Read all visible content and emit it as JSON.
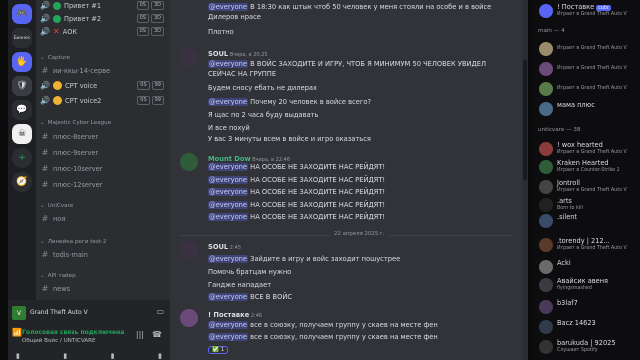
{
  "rail": {
    "servers": [
      "🎮",
      "Бизнес",
      "🖐",
      "🛡",
      "💬",
      "+",
      "🧭"
    ],
    "business_label": "Бизнес"
  },
  "channels": {
    "voice_users_top": [
      {
        "name": "Привет #1",
        "badges": [
          "0S",
          "3D"
        ]
      },
      {
        "name": "Привет #2",
        "badges": [
          "0S",
          "3D"
        ]
      },
      {
        "name": "АОК",
        "badges": [
          "0S",
          "3D"
        ]
      }
    ],
    "capture_cat": "Capture",
    "capture_server": "ии-ккы-14-серве",
    "cpt_users": [
      {
        "name": "CPT voice",
        "badges": [
          "0S",
          "99"
        ]
      },
      {
        "name": "CPT voice2",
        "badges": [
          "0S",
          "99"
        ]
      }
    ],
    "majestic_cat": "Majestic Cyber League",
    "majestic_channels": [
      "плюс-8server",
      "плюс-9server",
      "плюс-10server",
      "плюс-12server"
    ],
    "unicvare_cat": "UniCvare",
    "unicvare_channel": "ноя",
    "line2_cat": "Линейка реги test-2",
    "line2_channel": "todis-main",
    "api_cat": "API тайер",
    "api_channel": "news"
  },
  "panel": {
    "game": "Grand Theft Auto V",
    "voice_status": "Голосовая связь подключена",
    "voice_channel": "Общий Войс / UNTICVARE"
  },
  "chat": {
    "messages": [
      {
        "type": "line",
        "text": "В 18:30 как штык чтоб 50 человек у меня стояли на особе и в войсе",
        "mention": "@everyone"
      },
      {
        "type": "line",
        "text": "Дилеров нрасе"
      },
      {
        "type": "line",
        "text": "Плотно"
      },
      {
        "type": "header",
        "name": "SOUL",
        "time": "Вчера, в 20:25"
      },
      {
        "type": "line",
        "text": "В ВОЙС ЗАХОДИТЕ И ИГРУ, ЧТОБ Я МИНИМУМ 50 ЧЕЛОВЕК УВИДЕЛ",
        "mention": "@everyone"
      },
      {
        "type": "line",
        "text": "СЕЙЧАС НА ГРУППЕ"
      },
      {
        "type": "line",
        "text": "Будем сносу ебать не дилерах"
      },
      {
        "type": "line",
        "text": "Почему 20 человек в войсе всего?",
        "mention": "@everyone"
      },
      {
        "type": "line",
        "text": "Я щас по 2 часа буду выдавать"
      },
      {
        "type": "line",
        "text": "И все похуй"
      },
      {
        "type": "line",
        "text": "У вас 3 минуты всем в войсе и игро оказаться"
      },
      {
        "type": "header",
        "name": "Mount Dow",
        "time": "Вчера, в 22:46"
      },
      {
        "type": "line",
        "text": "НА ОСОБЕ НЕ ЗАХОДИТЕ НАС РЕЙДЯТ!",
        "mention": "@everyone"
      },
      {
        "type": "line",
        "text": "НА ОСОБЕ НЕ ЗАХОДИТЕ НАС РЕЙДЯТ!",
        "mention": "@everyone"
      },
      {
        "type": "line",
        "text": "НА ОСОБЕ НЕ ЗАХОДИТЕ НАС РЕЙДЯТ!",
        "mention": "@everyone"
      },
      {
        "type": "line",
        "text": "НА ОСОБЕ НЕ ЗАХОДИТЕ НАС РЕЙДЯТ!",
        "mention": "@everyone"
      },
      {
        "type": "line",
        "text": "НА ОСОБЕ НЕ ЗАХОДИТЕ НАС РЕЙДЯТ!",
        "mention": "@everyone"
      },
      {
        "type": "date",
        "text": "22 апреля 2025 г."
      },
      {
        "type": "header",
        "name": "SOUL",
        "time": "2:45"
      },
      {
        "type": "line",
        "text": "Зайдите в игру и войс заходит пошустрее",
        "mention": "@everyone"
      },
      {
        "type": "line",
        "text": "Помочь братцам нужно"
      },
      {
        "type": "line",
        "text": "Гандже нападает"
      },
      {
        "type": "line",
        "text": "ВСЕ В ВОЙС",
        "mention": "@everyone"
      },
      {
        "type": "header",
        "name": "! Поставке",
        "time": "2:46"
      },
      {
        "type": "line",
        "text": "все в союзку, получаем группу у скаев на месте фен",
        "mention": "@everyone"
      },
      {
        "type": "line",
        "text": "все в союзку, получаем группу у скаев на месте фен",
        "mention": "@everyone"
      }
    ],
    "reaction": "1"
  },
  "members": [
    {
      "name": "! Поставке",
      "status": "Играет в Grand Theft Auto V",
      "tag": "cuts"
    },
    {
      "category": "main — 4"
    },
    {
      "name": "",
      "status": "Играет в Grand Theft Auto V"
    },
    {
      "name": "",
      "status": "Играет в Grand Theft Auto V"
    },
    {
      "name": "",
      "status": "Играет в Grand Theft Auto V"
    },
    {
      "name": "мама плюс",
      "status": ""
    },
    {
      "category": "unticvare — 38"
    },
    {
      "name": "! wox hearted",
      "status": "Играет в Grand Theft Auto V"
    },
    {
      "name": "Kraken Hearted",
      "status": "Играет в Counter-Strike 2"
    },
    {
      "name": "Jontroll",
      "status": "Играет в Grand Theft Auto V"
    },
    {
      "name": ".arts",
      "status": "Born to kill"
    },
    {
      "name": ".silent",
      "status": ""
    },
    {
      "name": ".torendy | 212...",
      "status": "Играет в Grand Theft Auto V"
    },
    {
      "name": "Acki",
      "status": ""
    },
    {
      "name": "Авайсик авеня",
      "status": "flyingsmashed"
    },
    {
      "name": "b3laf7",
      "status": ""
    },
    {
      "name": "Bacz 14623",
      "status": ""
    },
    {
      "name": "barukuda | 92025",
      "status": "Слушает Spotify"
    }
  ]
}
